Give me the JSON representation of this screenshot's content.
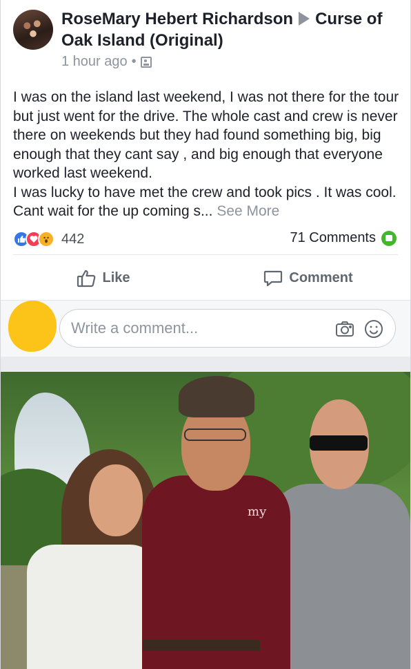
{
  "post": {
    "author": "RoseMary Hebert Richardson",
    "group": "Curse of Oak Island (Original)",
    "timestamp": "1 hour ago",
    "separator": "•",
    "body_lines": [
      "I was on the island last weekend, I was not there for the tour but just went for the drive. The whole cast and crew is never there on weekends but they had found something big, big enough that they cant say , and big enough that everyone worked last weekend.",
      "I was lucky to have met the crew and took pics . It was cool. Cant wait for the up coming s..."
    ],
    "see_more": "See More",
    "reaction_count": "442",
    "comments_count": "71 Comments",
    "reaction_icons": [
      "like-icon",
      "love-icon",
      "wow-icon"
    ]
  },
  "actions": {
    "like_label": "Like",
    "comment_label": "Comment"
  },
  "composer": {
    "placeholder": "Write a comment..."
  },
  "photo": {
    "logo_text": "my"
  },
  "colors": {
    "like_blue": "#3578e5",
    "love_red": "#f33e58",
    "wow_yellow": "#f7b125",
    "comment_green": "#42b72a",
    "avatar_yellow": "#fcc419"
  }
}
